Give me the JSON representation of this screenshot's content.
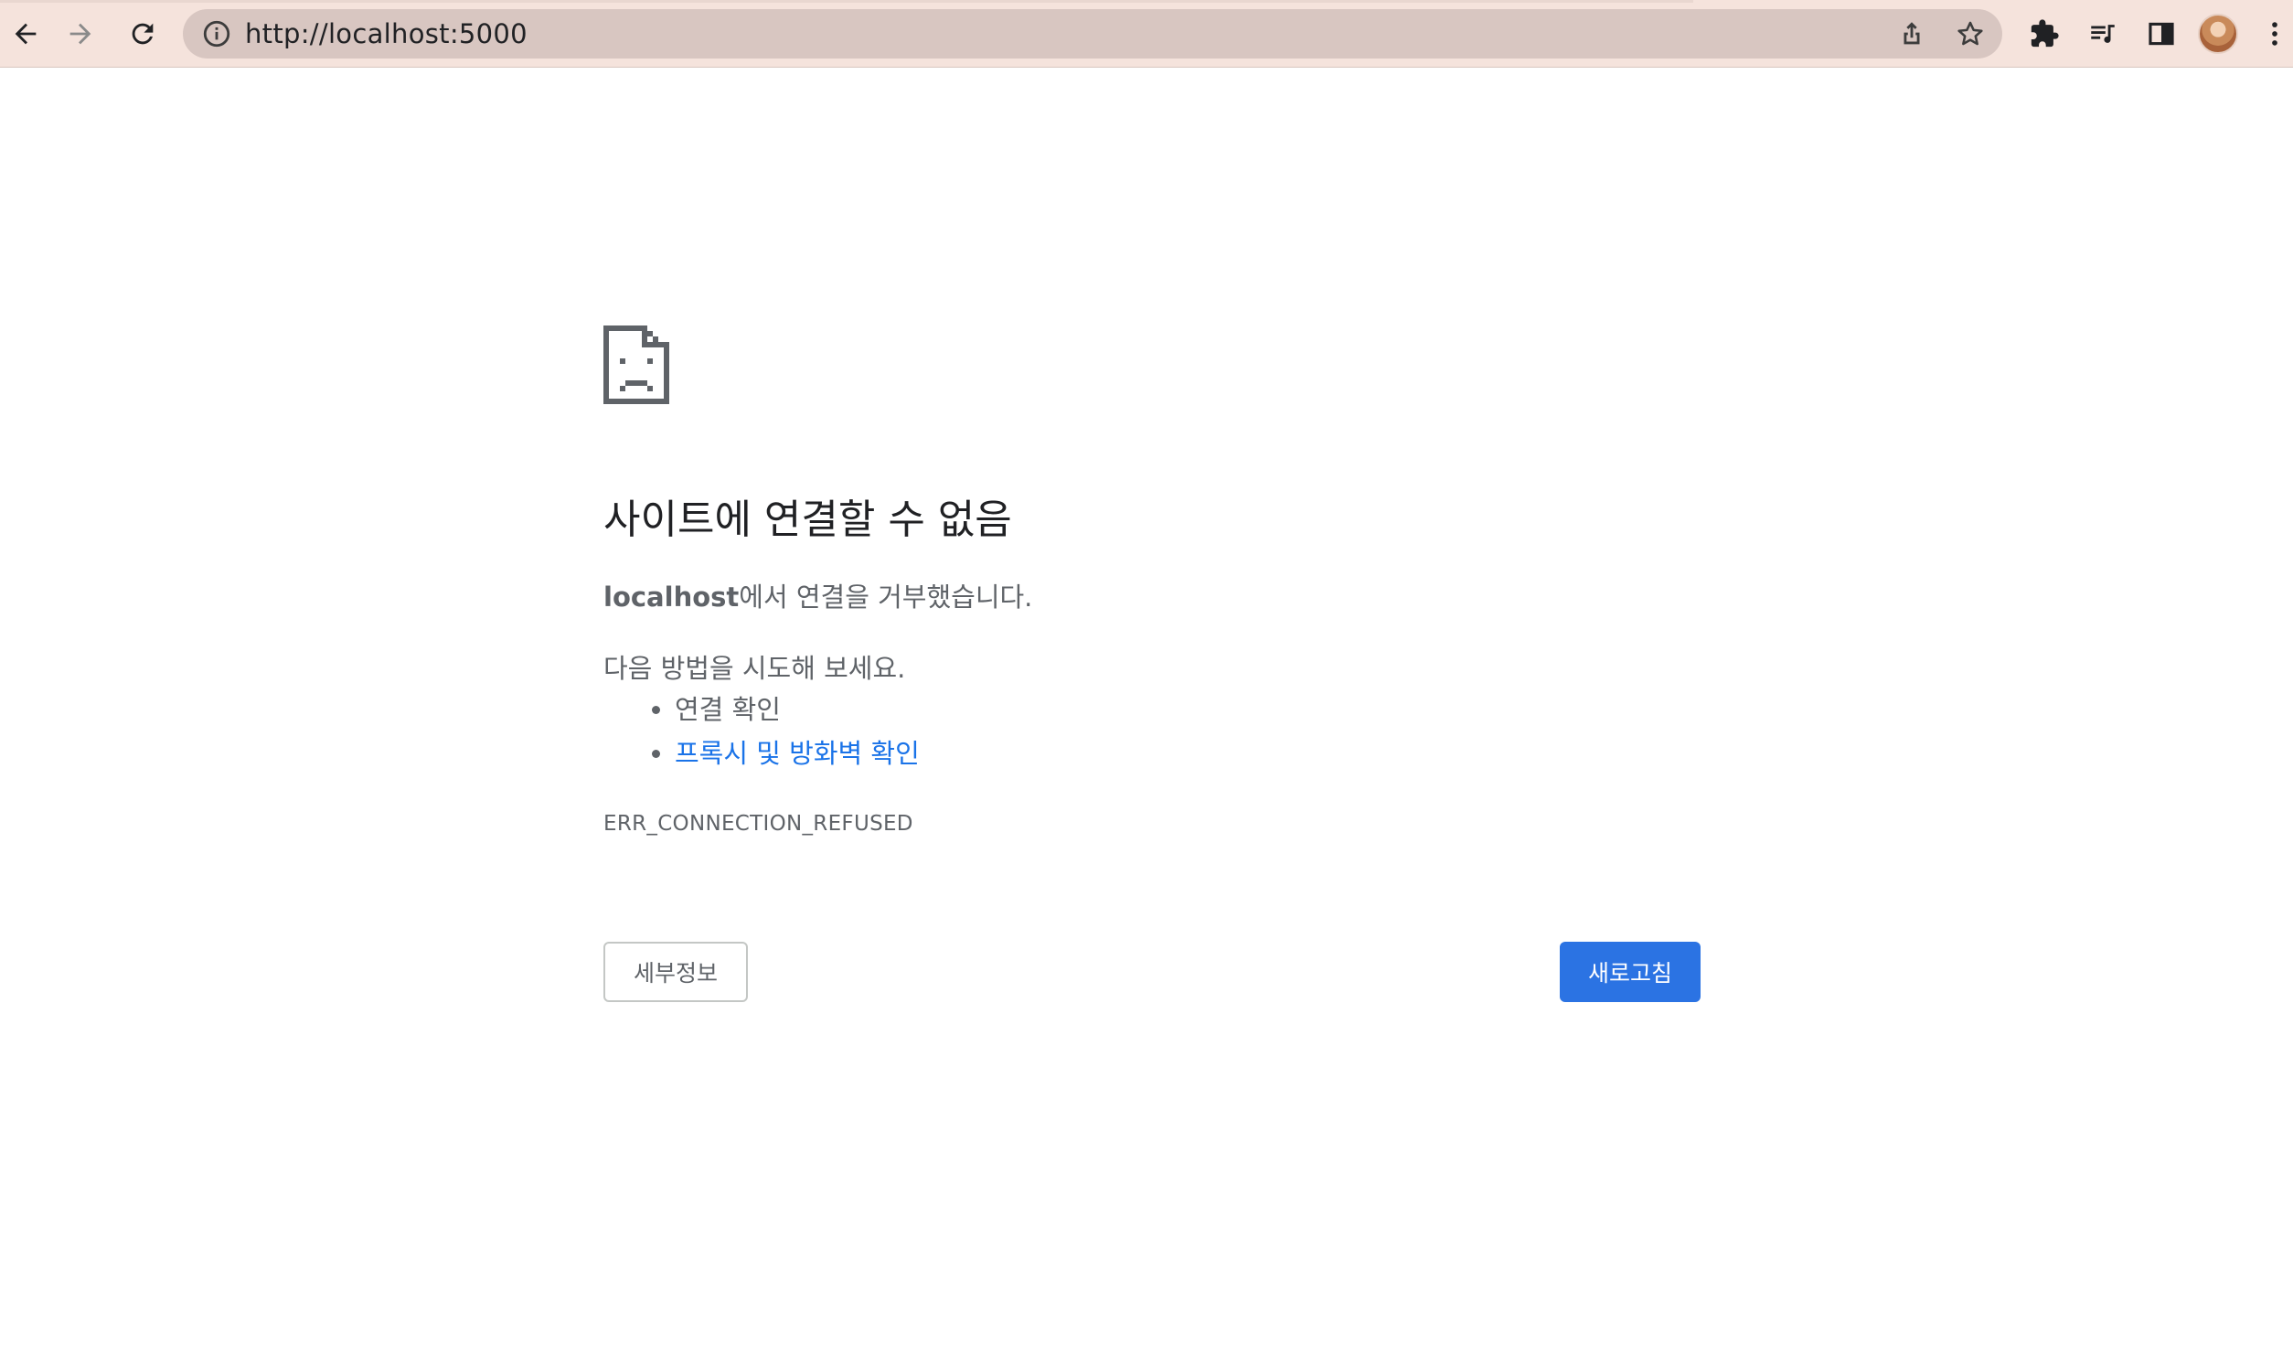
{
  "browser": {
    "url": "http://localhost:5000",
    "icons": {
      "back": "arrow-left-icon",
      "forward": "arrow-right-icon",
      "reload": "reload-icon",
      "site_info": "info-circle-icon",
      "share": "share-icon",
      "bookmark": "star-icon",
      "extensions": "puzzle-icon",
      "media": "media-queue-icon",
      "side_panel": "side-panel-icon",
      "avatar": "profile-avatar",
      "menu": "kebab-menu-icon"
    },
    "colors": {
      "toolbar": "#f5e3dc",
      "omnibox": "#d8c6c1"
    }
  },
  "error_page": {
    "icon": "sad-document-icon",
    "title": "사이트에 연결할 수 없음",
    "host": "localhost",
    "description_suffix": "에서 연결을 거부했습니다.",
    "suggestions_heading": "다음 방법을 시도해 보세요.",
    "suggestions": [
      {
        "label": "연결 확인",
        "link": false
      },
      {
        "label": "프록시 및 방화벽 확인",
        "link": true
      }
    ],
    "error_code": "ERR_CONNECTION_REFUSED",
    "details_button": "세부정보",
    "reload_button": "새로고침",
    "colors": {
      "link": "#1a73e8",
      "primary_button": "#2b73e3",
      "text": "#5f6368",
      "title": "#202124"
    }
  }
}
